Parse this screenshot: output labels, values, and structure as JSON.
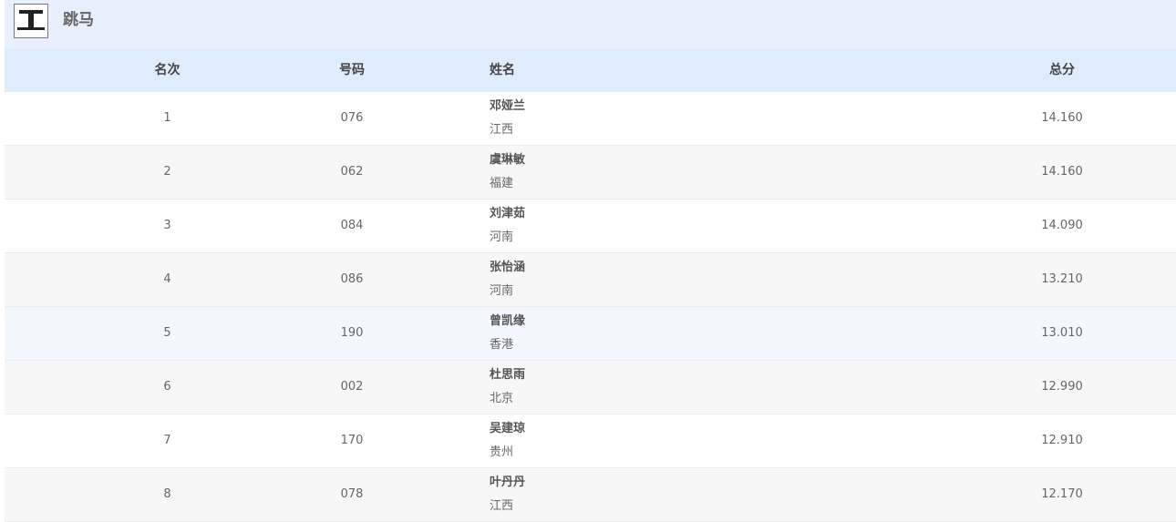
{
  "event": {
    "icon": "gymnastics-vault-icon",
    "title": "跳马"
  },
  "columns": {
    "rank": "名次",
    "bib": "号码",
    "name": "姓名",
    "score": "总分"
  },
  "rows": [
    {
      "rank": "1",
      "bib": "076",
      "name": "邓娅兰",
      "team": "江西",
      "score": "14.160"
    },
    {
      "rank": "2",
      "bib": "062",
      "name": "虞琳敏",
      "team": "福建",
      "score": "14.160"
    },
    {
      "rank": "3",
      "bib": "084",
      "name": "刘津茹",
      "team": "河南",
      "score": "14.090"
    },
    {
      "rank": "4",
      "bib": "086",
      "name": "张怡涵",
      "team": "河南",
      "score": "13.210"
    },
    {
      "rank": "5",
      "bib": "190",
      "name": "曾凯缘",
      "team": "香港",
      "score": "13.010"
    },
    {
      "rank": "6",
      "bib": "002",
      "name": "杜思雨",
      "team": "北京",
      "score": "12.990"
    },
    {
      "rank": "7",
      "bib": "170",
      "name": "吴建琼",
      "team": "贵州",
      "score": "12.910"
    },
    {
      "rank": "8",
      "bib": "078",
      "name": "叶丹丹",
      "team": "江西",
      "score": "12.170"
    }
  ],
  "colors": {
    "title_bar_bg": "#e8f0fd",
    "header_bg": "#dfecfc",
    "alt_row_bg": "#f7f7f7",
    "hover_row_bg": "#f3f8fe"
  }
}
